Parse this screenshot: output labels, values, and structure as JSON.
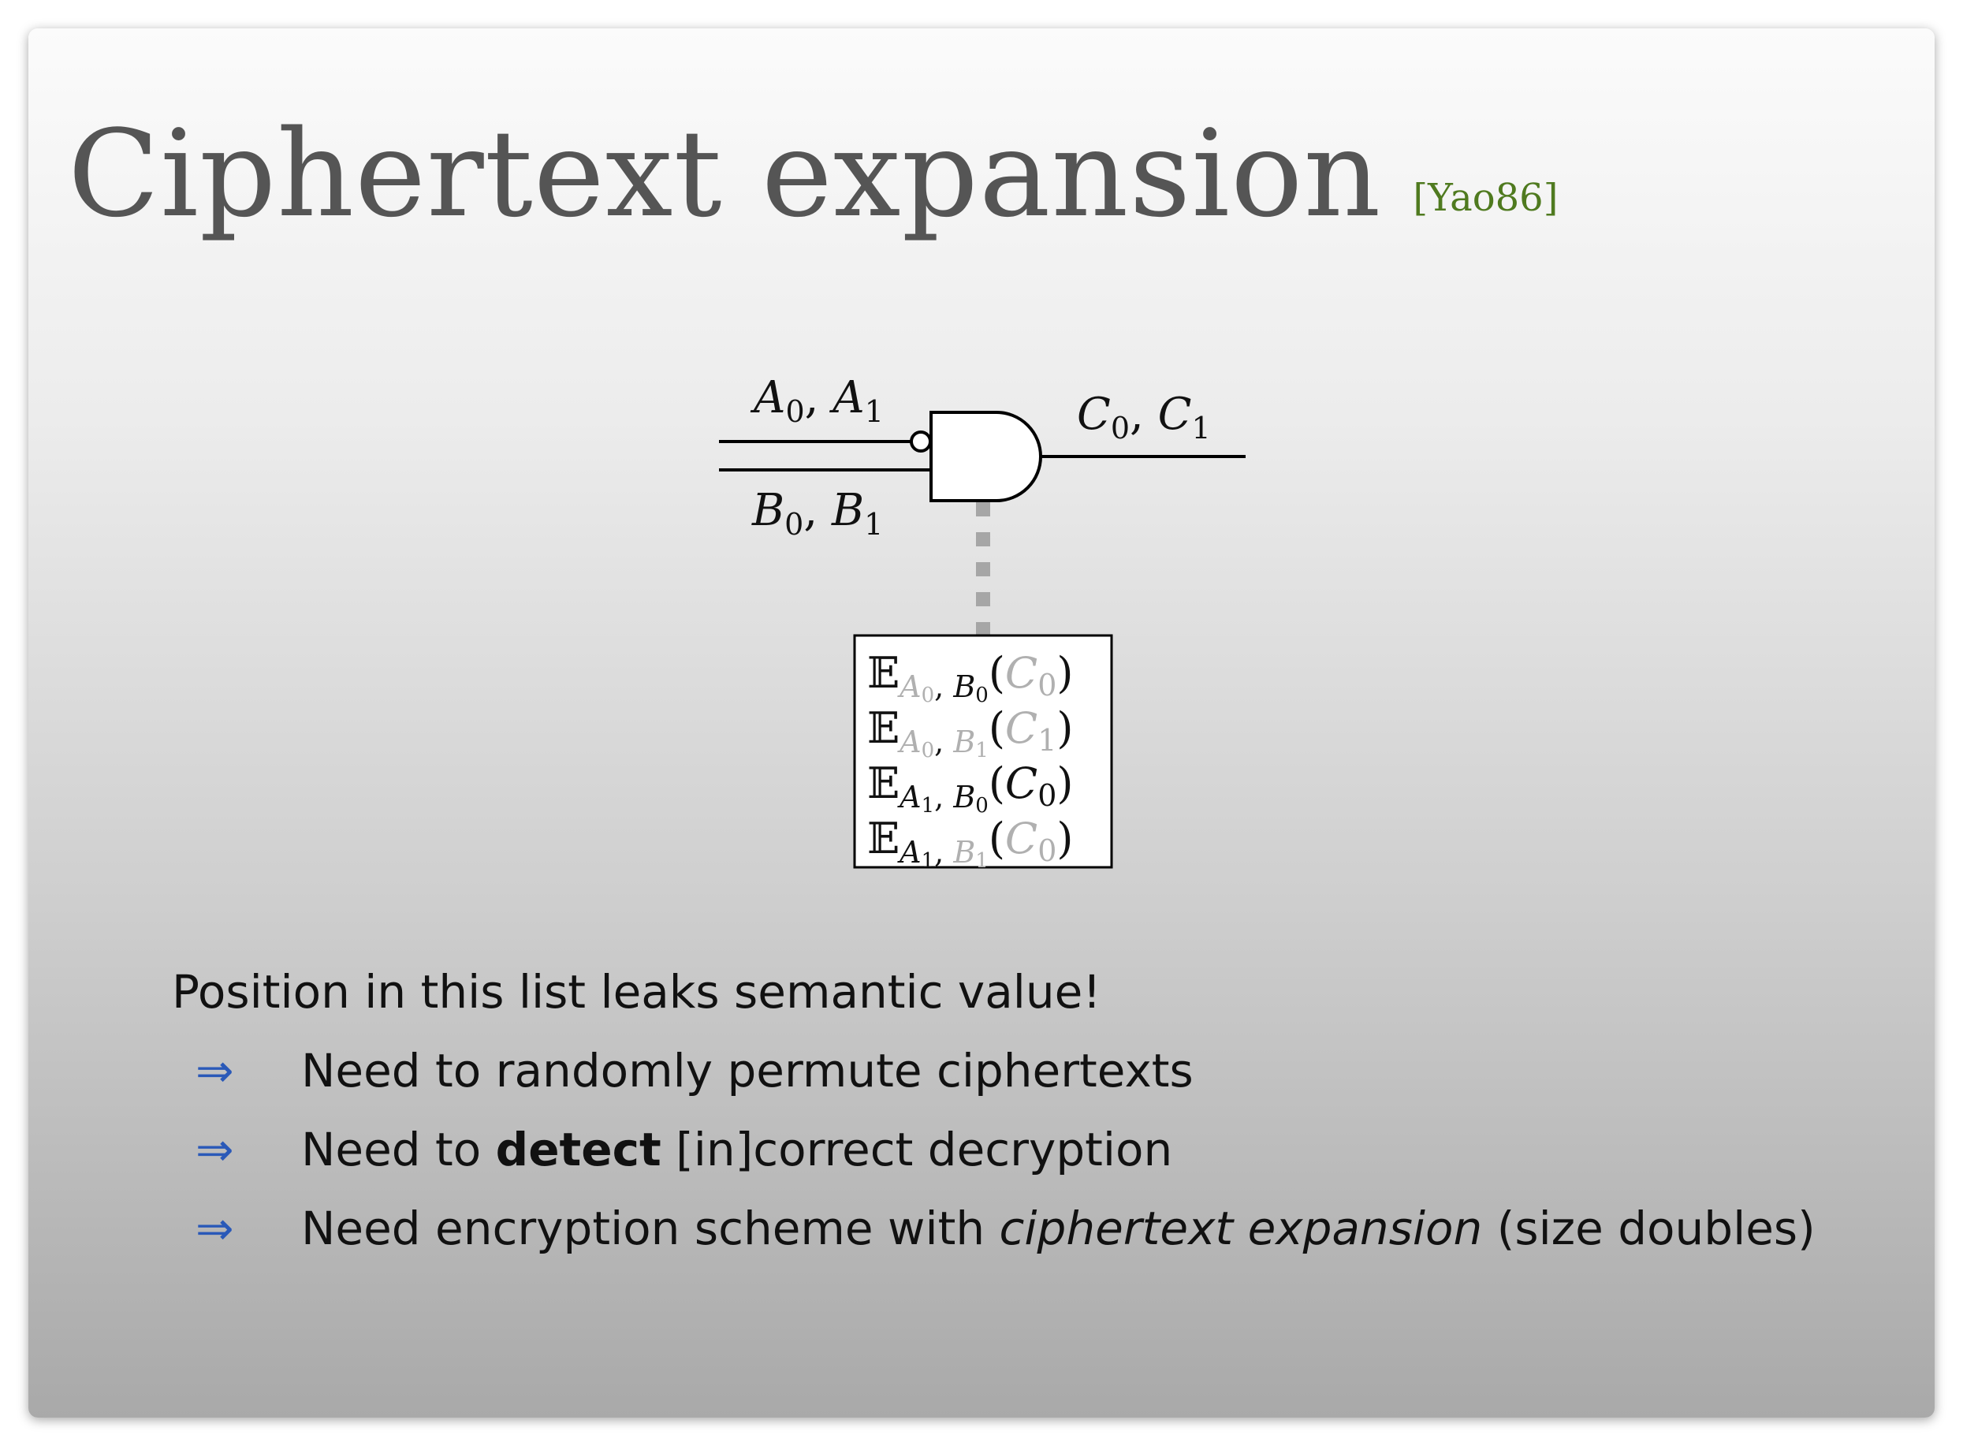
{
  "slide": {
    "title": "Ciphertext expansion",
    "citation": "[Yao86]"
  },
  "gate": {
    "input_a_label": {
      "base1": "A",
      "sub1": "0",
      "base2": "A",
      "sub2": "1"
    },
    "input_b_label": {
      "base1": "B",
      "sub1": "0",
      "base2": "B",
      "sub2": "1"
    },
    "output_label": {
      "base1": "C",
      "sub1": "0",
      "base2": "C",
      "sub2": "1"
    }
  },
  "table": {
    "rows": [
      {
        "E": "𝔼",
        "k1": "A",
        "k1s": "0",
        "k2": "B",
        "k2s": "0",
        "m": "C",
        "ms": "0"
      },
      {
        "E": "𝔼",
        "k1": "A",
        "k1s": "0",
        "k2": "B",
        "k2s": "1",
        "m": "C",
        "ms": "1"
      },
      {
        "E": "𝔼",
        "k1": "A",
        "k1s": "1",
        "k2": "B",
        "k2s": "0",
        "m": "C",
        "ms": "0"
      },
      {
        "E": "𝔼",
        "k1": "A",
        "k1s": "1",
        "k2": "B",
        "k2s": "1",
        "m": "C",
        "ms": "0"
      }
    ]
  },
  "body": {
    "intro": "Position in this list leaks semantic value!",
    "arrow_symbol": "⇒",
    "bullets": [
      {
        "text": "Need to randomly permute ciphertexts"
      },
      {
        "pre": "Need to ",
        "bold": "detect",
        "post": " [in]correct decryption"
      },
      {
        "pre": "Need encryption scheme with ",
        "italic": "ciphertext expansion",
        "post": " (size doubles)"
      }
    ]
  },
  "colors": {
    "title": "#555555",
    "citation": "#4f7a1f",
    "arrow": "#2a59b8",
    "faded": "#b0b0b0",
    "dotted_connector": "#a6a6a6"
  }
}
